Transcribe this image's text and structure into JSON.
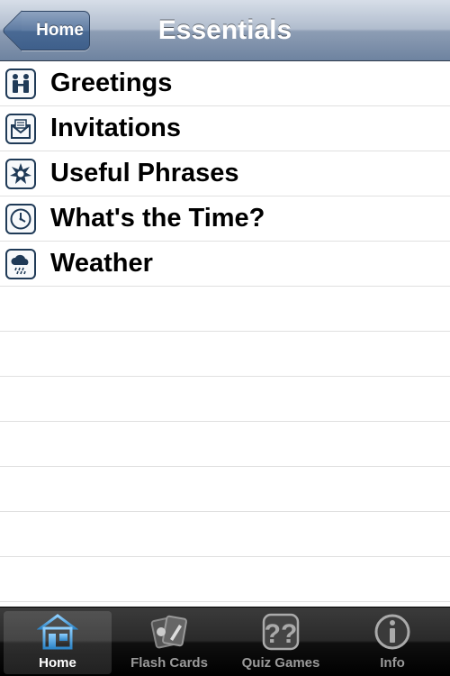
{
  "navbar": {
    "back_label": "Home",
    "title": "Essentials"
  },
  "list": {
    "items": [
      {
        "label": "Greetings",
        "icon": "greetings-icon"
      },
      {
        "label": "Invitations",
        "icon": "invitations-icon"
      },
      {
        "label": "Useful Phrases",
        "icon": "useful-phrases-icon"
      },
      {
        "label": "What's the Time?",
        "icon": "clock-icon"
      },
      {
        "label": "Weather",
        "icon": "weather-icon"
      }
    ]
  },
  "tabbar": {
    "tabs": [
      {
        "label": "Home",
        "icon": "home-icon",
        "active": true
      },
      {
        "label": "Flash Cards",
        "icon": "flash-cards-icon",
        "active": false
      },
      {
        "label": "Quiz Games",
        "icon": "quiz-games-icon",
        "active": false
      },
      {
        "label": "Info",
        "icon": "info-icon",
        "active": false
      }
    ]
  },
  "colors": {
    "navbar": "#8d9db4",
    "back_button": "#4a6a94",
    "icon_stroke": "#1f3a57",
    "tab_active_icon": "#4ea8e0",
    "tab_inactive": "#9a9a9a"
  }
}
